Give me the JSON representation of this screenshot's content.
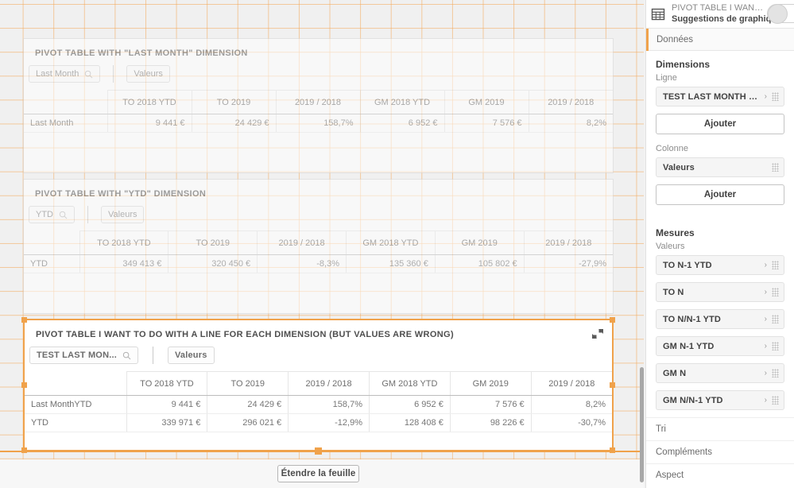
{
  "sheet": {
    "extend_button": "Étendre la feuille"
  },
  "objects": [
    {
      "title": "PIVOT TABLE WITH \"LAST MONTH\" DIMENSION",
      "row_pill": "Last Month",
      "col_pill": "Valeurs",
      "columns": [
        "TO 2018 YTD",
        "TO 2019",
        "2019 / 2018",
        "GM 2018 YTD",
        "GM 2019",
        "2019 / 2018"
      ],
      "rows": [
        {
          "label": "Last Month",
          "cells": [
            "9 441 €",
            "24 429 €",
            "158,7%",
            "6 952 €",
            "7 576 €",
            "8,2%"
          ]
        }
      ]
    },
    {
      "title": "PIVOT TABLE WITH \"YTD\" DIMENSION",
      "row_pill": "YTD",
      "col_pill": "Valeurs",
      "columns": [
        "TO 2018 YTD",
        "TO 2019",
        "2019 / 2018",
        "GM 2018 YTD",
        "GM 2019",
        "2019 / 2018"
      ],
      "rows": [
        {
          "label": "YTD",
          "cells": [
            "349 413 €",
            "320 450 €",
            "-8,3%",
            "135 360 €",
            "105 802 €",
            "-27,9%"
          ]
        }
      ]
    },
    {
      "title": "PIVOT TABLE I WANT TO DO WITH A LINE FOR EACH DIMENSION (BUT VALUES ARE WRONG)",
      "row_pill": "TEST LAST MON...",
      "col_pill": "Valeurs",
      "columns": [
        "TO 2018 YTD",
        "TO 2019",
        "2019 / 2018",
        "GM 2018 YTD",
        "GM 2019",
        "2019 / 2018"
      ],
      "rows": [
        {
          "label": "Last MonthYTD",
          "cells": [
            "9 441 €",
            "24 429 €",
            "158,7%",
            "6 952 €",
            "7 576 €",
            "8,2%"
          ]
        },
        {
          "label": "YTD",
          "cells": [
            "339 971 €",
            "296 021 €",
            "-12,9%",
            "128 408 €",
            "98 226 €",
            "-30,7%"
          ]
        }
      ]
    }
  ],
  "panel": {
    "header": {
      "object_title": "PIVOT TABLE I WANT TO...",
      "subtitle": "Suggestions de graphique"
    },
    "tab": "Données",
    "dimensions": {
      "title": "Dimensions",
      "line_label": "Ligne",
      "line_fields": [
        "TEST LAST MONTH & YTD"
      ],
      "line_add": "Ajouter",
      "column_label": "Colonne",
      "column_fields": [
        "Valeurs"
      ],
      "column_add": "Ajouter"
    },
    "measures": {
      "title": "Mesures",
      "values_label": "Valeurs",
      "fields": [
        "TO N-1 YTD",
        "TO N",
        "TO N/N-1 YTD",
        "GM N-1 YTD",
        "GM N",
        "GM N/N-1 YTD"
      ]
    },
    "accordion": [
      "Tri",
      "Compléments",
      "Aspect"
    ]
  },
  "colors": {
    "accent": "#f0a24b",
    "grid": "#f4a654",
    "text": "#6f6f6f"
  }
}
